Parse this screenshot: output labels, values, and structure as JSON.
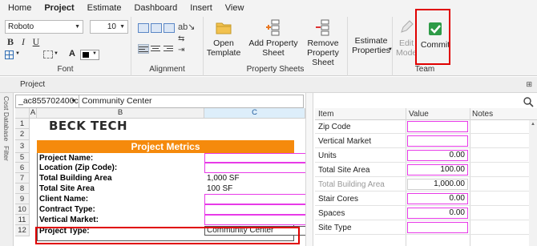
{
  "tabs": [
    "Home",
    "Project",
    "Estimate",
    "Dashboard",
    "Insert",
    "View"
  ],
  "font": {
    "family": "Roboto",
    "size": "10",
    "group_label": "Font",
    "color_letter": "A"
  },
  "alignment": {
    "group_label": "Alignment"
  },
  "property_sheets": {
    "group_label": "Property Sheets",
    "open_template": "Open\nTemplate",
    "add": "Add Property\nSheet",
    "remove": "Remove\nProperty Sheet"
  },
  "estimate_properties": "Estimate\nProperties",
  "team": {
    "group_label": "Team",
    "edit_mode": "Edit\nMode",
    "commit": "Commit"
  },
  "panel": {
    "title": "Project"
  },
  "vtabs": [
    "Cost Database",
    "Filter"
  ],
  "selector": {
    "id": "_ac855702400c",
    "name": "Community Center"
  },
  "sheet": {
    "columns": [
      "A",
      "B",
      "C"
    ],
    "row_numbers": [
      "1",
      "2",
      "3",
      "5",
      "6",
      "7",
      "8",
      "9",
      "10",
      "11",
      "12"
    ],
    "logo": "BECK TECH",
    "metrics_title": "Project Metrics",
    "rows": [
      {
        "label": "Project Name:",
        "value": ""
      },
      {
        "label": "Location (Zip Code):",
        "value": ""
      },
      {
        "label": "Total Building Area",
        "value": "1,000 SF"
      },
      {
        "label": "Total Site Area",
        "value": "100 SF"
      },
      {
        "label": "Client Name:",
        "value": ""
      },
      {
        "label": "Contract Type:",
        "value": ""
      },
      {
        "label": "Vertical Market:",
        "value": ""
      }
    ],
    "project_type_label": "Project Type:",
    "project_type_value": "Community Center"
  },
  "property_grid": {
    "headers": [
      "Item",
      "Value",
      "Notes"
    ],
    "rows": [
      {
        "item": "Zip Code",
        "value": "",
        "disabled": false
      },
      {
        "item": "Vertical Market",
        "value": "",
        "disabled": false
      },
      {
        "item": "Units",
        "value": "0.00",
        "disabled": false
      },
      {
        "item": "Total Site Area",
        "value": "100.00",
        "disabled": false
      },
      {
        "item": "Total Building Area",
        "value": "1,000.00",
        "disabled": true
      },
      {
        "item": "Stair Cores",
        "value": "0.00",
        "disabled": false
      },
      {
        "item": "Spaces",
        "value": "0.00",
        "disabled": false
      },
      {
        "item": "Site Type",
        "value": "",
        "disabled": false
      }
    ]
  },
  "colors": {
    "accent_orange": "#f58a0c",
    "highlight_red": "#e00000",
    "input_border_magenta": "#e83ae8"
  }
}
